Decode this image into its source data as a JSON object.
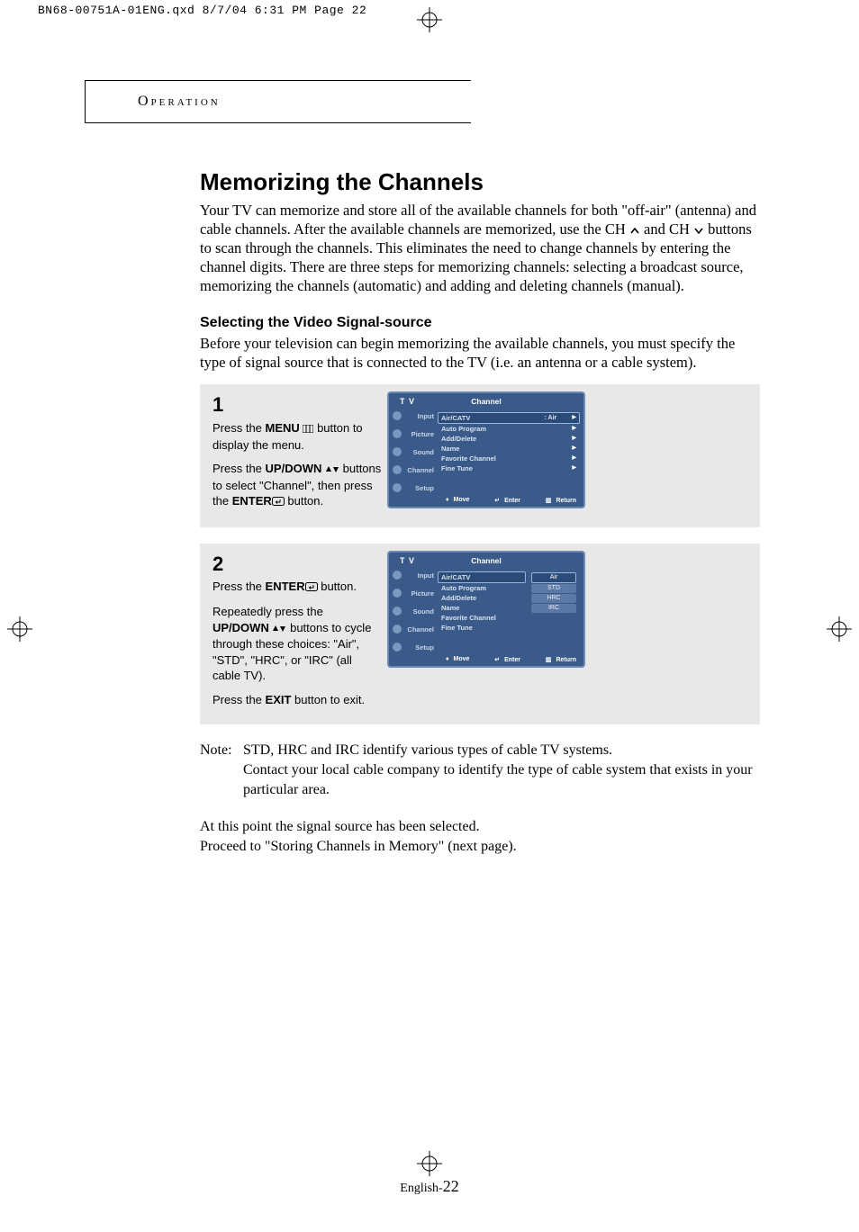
{
  "print_header": "BN68-00751A-01ENG.qxd  8/7/04 6:31 PM  Page 22",
  "section_tab": "Operation",
  "title": "Memorizing the Channels",
  "intro_parts": {
    "a": "Your TV can memorize and store all of the available channels for both \"off-air\" (antenna) and cable channels. After the available channels are memorized, use the CH ",
    "b": " and CH ",
    "c": " buttons to scan through the channels. This eliminates the need to change channels by entering the channel digits. There are three steps for memorizing channels: selecting a broadcast source, memorizing the channels (automatic) and adding and deleting channels (manual)."
  },
  "subhead": "Selecting the Video Signal-source",
  "subtext": "Before your television can begin memorizing the available channels, you must specify the type of signal source that is connected to the TV (i.e. an antenna or a cable system).",
  "step1": {
    "num": "1",
    "p1a": "Press the ",
    "p1b": "MENU",
    "p1c": " button to display the menu.",
    "p2a": "Press the ",
    "p2b": "UP/DOWN",
    "p2c": " buttons to select \"Channel\", then press the ",
    "p2d": "ENTER",
    "p2e": " button."
  },
  "step2": {
    "num": "2",
    "p1a": "Press the ",
    "p1b": "ENTER",
    "p1c": " button.",
    "p2a": "Repeatedly press the ",
    "p2b": "UP/DOWN",
    "p2c": " buttons to cycle through these choices: \"Air\", \"STD\", \"HRC\", or \"IRC\" (all cable TV).",
    "p3a": "Press the ",
    "p3b": "EXIT",
    "p3c": " button to exit."
  },
  "osd": {
    "tv": "T V",
    "title": "Channel",
    "sidebar": [
      "Input",
      "Picture",
      "Sound",
      "Channel",
      "Setup"
    ],
    "menu": [
      {
        "label": "Air/CATV",
        "val": ": Air"
      },
      {
        "label": "Auto Program"
      },
      {
        "label": "Add/Delete"
      },
      {
        "label": "Name"
      },
      {
        "label": "Favorite Channel"
      },
      {
        "label": "Fine Tune"
      }
    ],
    "footer": {
      "move": "Move",
      "enter": "Enter",
      "return": "Return"
    }
  },
  "osd2": {
    "options": [
      "Air",
      "STD",
      "HRC",
      "IRC"
    ]
  },
  "note": {
    "label": "Note:",
    "l1": "STD, HRC and IRC identify various types of cable TV systems.",
    "l2": "Contact your local cable company to identify the type of cable system that exists in your particular area."
  },
  "closing": {
    "l1": "At this point the signal source has been selected.",
    "l2": "Proceed to \"Storing Channels in Memory\"  (next page)."
  },
  "footer": {
    "lang": "English-",
    "page": "22"
  }
}
